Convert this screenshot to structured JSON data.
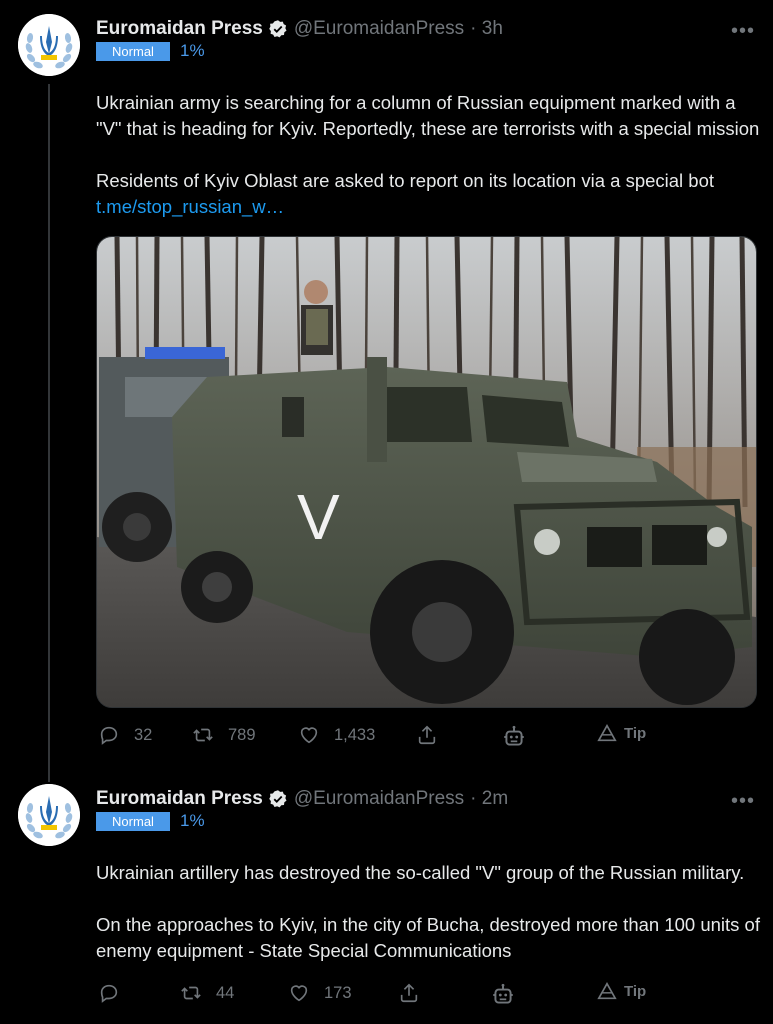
{
  "tweets": [
    {
      "name": "Euromaidan Press",
      "handle": "@EuromaidanPress",
      "time": "· 3h",
      "badge": "Normal",
      "percent": "1%",
      "text": "Ukrainian army is searching for a column of Russian equipment marked with a \"V\" that is heading for Kyiv. Reportedly, these are terrorists with a special mission\n\nResidents of Kyiv Oblast are asked to report on its location via a special bot",
      "link": "t.me/stop_russian_w…",
      "replies": "32",
      "retweets": "789",
      "likes": "1,433",
      "tip": "Tip",
      "media_icon": "armored-vehicle-photo",
      "vehicle_mark": "V"
    },
    {
      "name": "Euromaidan Press",
      "handle": "@EuromaidanPress",
      "time": "· 2m",
      "badge": "Normal",
      "percent": "1%",
      "text": "Ukrainian artillery has destroyed the so-called \"V\" group of the Russian military.\n\nOn the approaches to Kyiv, in the city of Bucha, destroyed more than 100 units of enemy equipment - State Special Communications",
      "replies": "",
      "retweets": "44",
      "likes": "173",
      "tip": "Tip"
    }
  ],
  "more_label": "•••",
  "colors": {
    "accent": "#1d9bf0",
    "badge": "#4a99e9",
    "muted": "#71767b",
    "background": "#000000"
  }
}
